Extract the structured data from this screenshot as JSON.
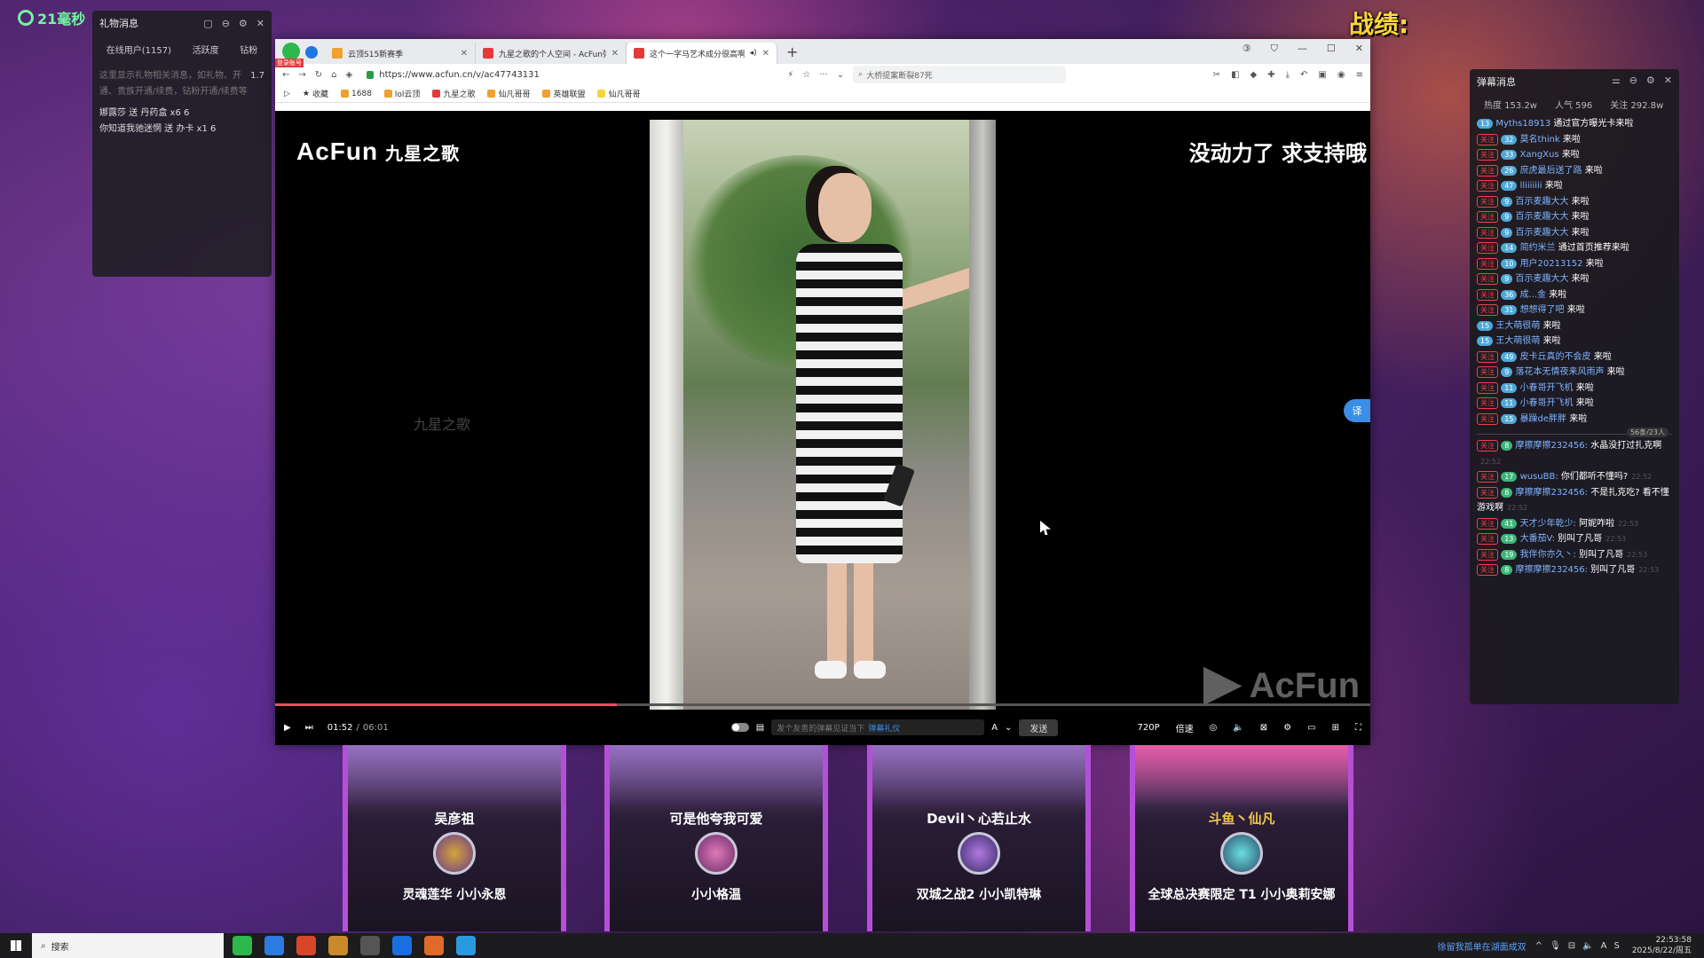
{
  "overlay": {
    "counter": "21毫秒",
    "zhanji": "战绩:"
  },
  "gift_panel": {
    "title": "礼物消息",
    "tabs": [
      "在线用户(1157)",
      "活跃度",
      "钻粉"
    ],
    "hint": "这里显示礼物相关消息，如礼物、开通、贵族开通/续费，钻粉开通/续费等",
    "hint_count": "1.7",
    "lines": [
      "娜露莎 送 丹药盒  x6  6",
      "你知道我驰迷惘 送 办卡  x1  6"
    ]
  },
  "browser": {
    "tabs": [
      {
        "title": "云顶S15新赛季",
        "active": false
      },
      {
        "title": "九星之歌的个人空间 - AcFun弹...",
        "active": false
      },
      {
        "title": "这个一字马艺术成分很高啊",
        "active": true
      }
    ],
    "login_badge": "登录账号",
    "url": "https://www.acfun.cn/v/ac47743131",
    "search_placeholder": "大桥提案断裂87死",
    "bookmarks": [
      "收藏",
      "1688",
      "lol云顶",
      "九星之歌",
      "仙凡哥哥",
      "英雄联盟",
      "仙凡哥哥"
    ]
  },
  "video": {
    "logo": "AcFun",
    "channel": "九星之歌",
    "caption": "没动力了 求支持哦",
    "watermark_left": "九星之歌",
    "watermark_br": "AcFun",
    "translate_label": "译",
    "progress": 0.312,
    "current_time": "01:52",
    "total_time": "06:01",
    "danmaku_placeholder": "发个友善的弹幕见证当下",
    "danmaku_link": "弹幕礼仪",
    "send_label": "发送",
    "quality": "720P",
    "speed": "倍速"
  },
  "cards": [
    {
      "player": "吴彦祖",
      "skin": "灵魂莲华 小小永恩",
      "gold": false
    },
    {
      "player": "可是他夸我可爱",
      "skin": "小小格温",
      "gold": false
    },
    {
      "player": "Devil丶心若止水",
      "skin": "双城之战2 小小凯特琳",
      "gold": false
    },
    {
      "player": "斗鱼丶仙凡",
      "skin": "全球总决赛限定 T1 小小奥莉安娜",
      "gold": true
    }
  ],
  "chat": {
    "title": "弹幕消息",
    "stats": [
      "热度 153.2w",
      "人气 596",
      "关注 292.8w"
    ],
    "follow_label": "关注",
    "messages": [
      {
        "lv": "13",
        "user": "Myths18913",
        "text": "通过官方曝光卡来啦",
        "follow": false
      },
      {
        "lv": "32",
        "user": "莫名think",
        "text": "来啦",
        "follow": true
      },
      {
        "lv": "33",
        "user": "XangXus",
        "text": "来啦",
        "follow": true
      },
      {
        "lv": "26",
        "user": "庶虎最后送了路",
        "text": "来啦",
        "follow": true
      },
      {
        "lv": "47",
        "user": "lliiiiiii",
        "text": "来啦",
        "follow": true
      },
      {
        "lv": "9",
        "user": "百示麦趣大大",
        "text": "来啦",
        "follow": true
      },
      {
        "lv": "9",
        "user": "百示麦趣大大",
        "text": "来啦",
        "follow": true
      },
      {
        "lv": "9",
        "user": "百示麦趣大大",
        "text": "来啦",
        "follow": true
      },
      {
        "lv": "14",
        "user": "简约米兰",
        "text": "通过首页推荐来啦",
        "follow": true
      },
      {
        "lv": "10",
        "user": "用户20213152",
        "text": "来啦",
        "follow": true
      },
      {
        "lv": "9",
        "user": "百示麦趣大大",
        "text": "来啦",
        "follow": true
      },
      {
        "lv": "36",
        "user": "成...金",
        "text": "来啦",
        "follow": true
      },
      {
        "lv": "31",
        "user": "想想得了吧",
        "text": "来啦",
        "follow": true
      },
      {
        "lv": "15",
        "user": "王大萌很萌",
        "text": "来啦",
        "follow": false
      },
      {
        "lv": "15",
        "user": "王大萌很萌",
        "text": "来啦",
        "follow": false
      },
      {
        "lv": "49",
        "user": "皮卡丘真的不会皮",
        "text": "来啦",
        "follow": true
      },
      {
        "lv": "9",
        "user": "落花本无情夜来风雨声",
        "text": "来啦",
        "follow": true
      },
      {
        "lv": "11",
        "user": "小春哥开飞机",
        "text": "来啦",
        "follow": true
      },
      {
        "lv": "11",
        "user": "小春哥开飞机",
        "text": "来啦",
        "follow": true
      },
      {
        "lv": "15",
        "user": "暴躁de胖胖",
        "text": "来啦",
        "follow": true
      }
    ],
    "divider_badge": "56条/23人",
    "chats": [
      {
        "lv": "8",
        "user": "摩擦摩擦232456:",
        "text": "水晶没打过扎克啊",
        "time": "22:52"
      },
      {
        "lv": "17",
        "user": "wusuBB:",
        "text": "你们都听不懂吗?",
        "time": "22:52"
      },
      {
        "lv": "8",
        "user": "摩擦摩擦232456:",
        "text": "不是扎克吃? 看不懂游戏啊",
        "time": "22:52"
      },
      {
        "lv": "41",
        "user": "天才少年乾少:",
        "text": "阿妮咋啦",
        "time": "22:53"
      },
      {
        "lv": "13",
        "user": "大番茄V:",
        "text": "别叫了凡哥",
        "time": "22:53"
      },
      {
        "lv": "19",
        "user": "我伴你亦久丶:",
        "text": "别叫了凡哥",
        "time": "22:53"
      },
      {
        "lv": "8",
        "user": "摩擦摩擦232456:",
        "text": "别叫了凡哥",
        "time": "22:53"
      }
    ]
  },
  "taskbar": {
    "search": "搜索",
    "ticker": "徐留我孤单在湖面成双",
    "time": "22:53:58",
    "date": "2025/8/22/周五"
  }
}
